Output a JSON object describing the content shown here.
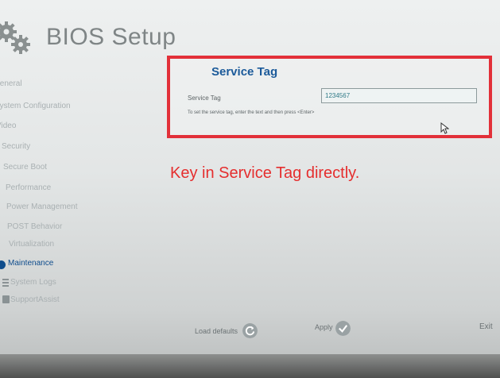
{
  "app": {
    "title": "BIOS Setup"
  },
  "sidebar": {
    "items": [
      {
        "label": "General",
        "active": false
      },
      {
        "label": "System Configuration",
        "active": false
      },
      {
        "label": "Video",
        "active": false
      },
      {
        "label": "Security",
        "active": false
      },
      {
        "label": "Secure Boot",
        "active": false
      },
      {
        "label": "Performance",
        "active": false
      },
      {
        "label": "Power Management",
        "active": false
      },
      {
        "label": "POST Behavior",
        "active": false
      },
      {
        "label": "Virtualization",
        "active": false
      },
      {
        "label": "Maintenance",
        "active": true
      },
      {
        "label": "System Logs",
        "active": false
      },
      {
        "label": "SupportAssist",
        "active": false
      }
    ]
  },
  "panel": {
    "title": "Service Tag",
    "field_label": "Service Tag",
    "field_value": "1234567",
    "help": "To set the service tag, enter the text and then press <Enter>"
  },
  "annotation": {
    "text": "Key in Service Tag directly."
  },
  "footer": {
    "load_defaults_label": "Load defaults",
    "apply_label": "Apply",
    "exit_label": "Exit"
  },
  "colors": {
    "highlight_border": "#e23039",
    "annotation_text": "#e52e2e",
    "active_nav": "#0e4c8c",
    "panel_title": "#1b5a9a",
    "button_circle": "#9aa2a4"
  },
  "icons": {
    "logo": "gears-icon",
    "load_defaults": "refresh-icon",
    "apply": "checkmark-icon",
    "pointer": "mouse-pointer-icon"
  }
}
